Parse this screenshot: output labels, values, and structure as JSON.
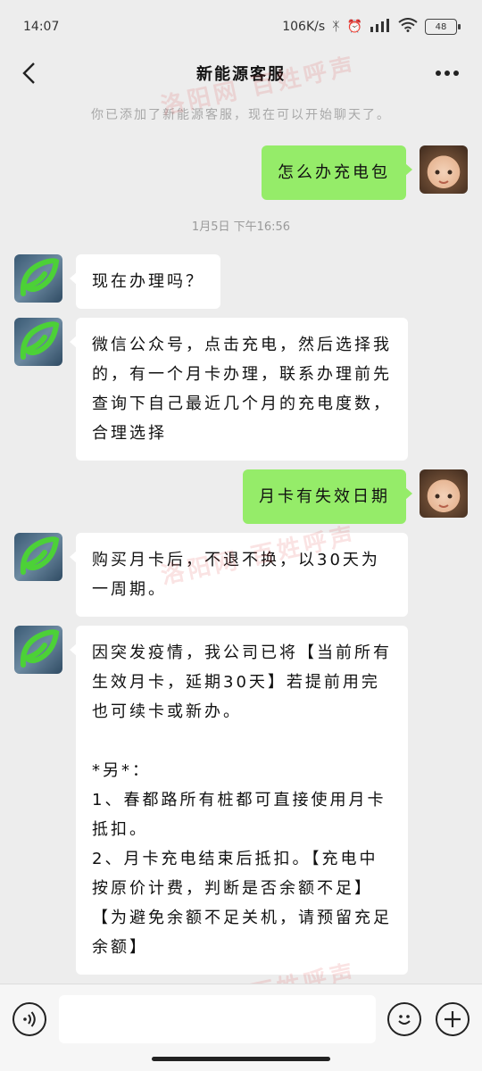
{
  "status_bar": {
    "time": "14:07",
    "network_speed": "106K/s",
    "battery": "48",
    "icons": [
      "bluetooth-icon",
      "alarm-icon",
      "signal-icon",
      "wifi-icon",
      "battery-icon"
    ]
  },
  "header": {
    "title": "新能源客服",
    "back_icon": "chevron-left-icon",
    "more_icon": "more-dots-icon"
  },
  "system_note": "你已添加了新能源客服，现在可以开始聊天了。",
  "timestamp": "1月5日 下午16:56",
  "messages": [
    {
      "sender": "user",
      "text": "怎么办充电包"
    },
    {
      "sender": "bot",
      "text": "现在办理吗？"
    },
    {
      "sender": "bot",
      "text": "微信公众号，点击充电，然后选择我的，有一个月卡办理，联系办理前先查询下自己最近几个月的充电度数，合理选择"
    },
    {
      "sender": "user",
      "text": "月卡有失效日期"
    },
    {
      "sender": "bot",
      "text": "购买月卡后，不退不换，以30天为一周期。"
    },
    {
      "sender": "bot",
      "text": "因突发疫情，我公司已将【当前所有生效月卡，延期30天】若提前用完也可续卡或新办。\n\n*另*：\n1、春都路所有桩都可直接使用月卡抵扣。\n2、月卡充电结束后抵扣。【充电中按原价计费，判断是否余额不足】【为避免余额不足关机，请预留充足余额】"
    }
  ],
  "input_bar": {
    "voice_icon": "voice-icon",
    "emoji_icon": "emoji-icon",
    "plus_icon": "plus-icon"
  },
  "watermark": "洛阳网 百姓呼声",
  "colors": {
    "background": "#ededed",
    "user_bubble": "#95ec69",
    "bot_bubble": "#ffffff",
    "bot_logo": "#4cd137"
  }
}
